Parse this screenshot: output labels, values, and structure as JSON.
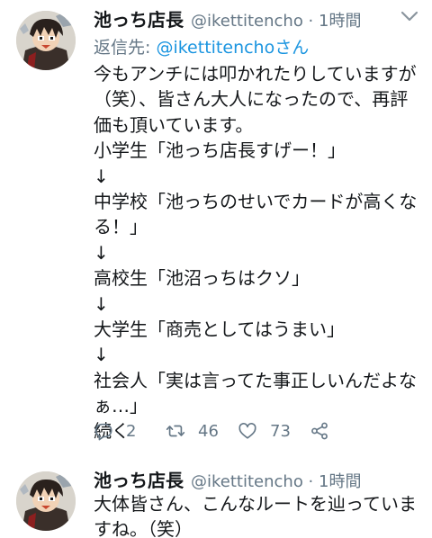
{
  "tweets": [
    {
      "display_name": "池っち店長",
      "meta": "@ikettitencho · 1時間",
      "reply_prefix": "返信先: ",
      "reply_handle": "@ikettitenchoさん",
      "lines": [
        "今もアンチには叩かれたりしていますが",
        "（笑）、皆さん大人になったので、再評",
        "価も頂いています。",
        "小学生「池っち店長すげー！」",
        "↓",
        "中学校「池っちのせいでカードが高くな",
        "る！」",
        "↓",
        "高校生「池沼っちはクソ」",
        "↓",
        "大学生「商売としてはうまい」",
        "↓",
        "社会人「実は言ってた事正しいんだよな",
        "ぁ…」",
        "続く"
      ],
      "actions": {
        "reply_count": "2",
        "retweet_count": "46",
        "like_count": "73"
      }
    },
    {
      "display_name": "池っち店長",
      "meta": "@ikettitencho · 1時間",
      "lines": [
        "大体皆さん、こんなルートを辿っていま",
        "すね。（笑）"
      ]
    }
  ],
  "colors": {
    "text": "#14171a",
    "secondary": "#657786",
    "link": "#1b95e0"
  },
  "icons": [
    "chevron-down-icon",
    "reply-icon",
    "retweet-icon",
    "like-icon",
    "share-icon"
  ]
}
